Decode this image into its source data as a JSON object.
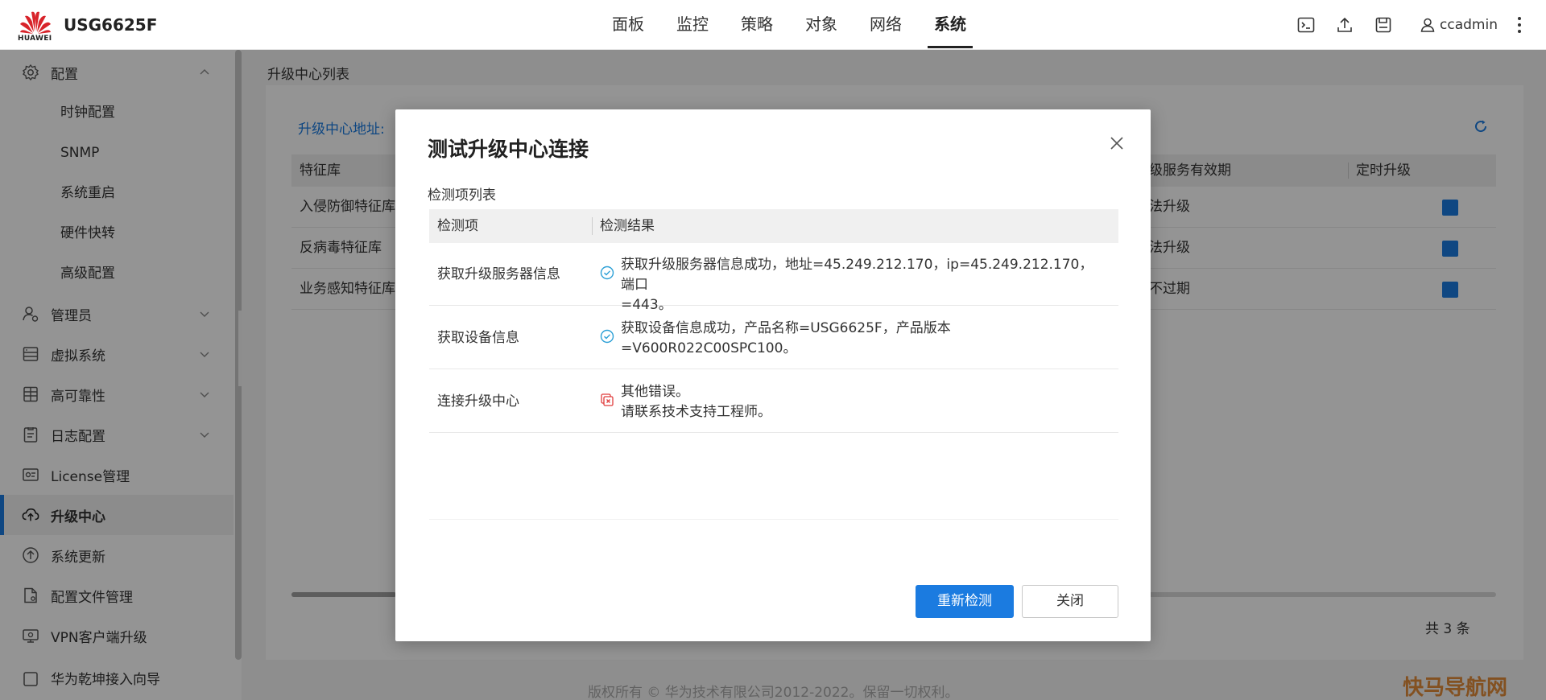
{
  "header": {
    "logo_text": "HUAWEI",
    "device": "USG6625F",
    "nav": [
      "面板",
      "监控",
      "策略",
      "对象",
      "网络",
      "系统"
    ],
    "active_nav": "系统",
    "user": "ccadmin"
  },
  "sidebar": {
    "config": "配置",
    "config_children": [
      "时钟配置",
      "SNMP",
      "系统重启",
      "硬件快转",
      "高级配置"
    ],
    "items": [
      "管理员",
      "虚拟系统",
      "高可靠性",
      "日志配置",
      "License管理",
      "升级中心",
      "系统更新",
      "配置文件管理",
      "VPN客户端升级",
      "华为乾坤接入向导"
    ],
    "active": "升级中心"
  },
  "main": {
    "breadcrumb": "升级中心列表",
    "address_label": "升级中心地址:",
    "columns": [
      "特征库",
      "级服务有效期",
      "定时升级"
    ],
    "rows": [
      {
        "name": "入侵防御特征库",
        "validity": "法升级",
        "scheduled": true
      },
      {
        "name": "反病毒特征库",
        "validity": "法升级",
        "scheduled": true
      },
      {
        "name": "业务感知特征库",
        "validity": "不过期",
        "scheduled": true
      }
    ],
    "total": "共 3 条",
    "footer": "版权所有 © 华为技术有限公司2012-2022。保留一切权利。",
    "watermark": "快马导航网"
  },
  "modal": {
    "title": "测试升级中心连接",
    "subtitle": "检测项列表",
    "columns": [
      "检测项",
      "检测结果"
    ],
    "rows": [
      {
        "item": "获取升级服务器信息",
        "status": "success",
        "line1": "获取升级服务器信息成功，地址=45.249.212.170，ip=45.249.212.170，端口",
        "line2": "=443。"
      },
      {
        "item": "获取设备信息",
        "status": "success",
        "line1": "获取设备信息成功，产品名称=USG6625F，产品版本",
        "line2": "=V600R022C00SPC100。"
      },
      {
        "item": "连接升级中心",
        "status": "error",
        "line1": "其他错误。",
        "line2": "请联系技术支持工程师。"
      }
    ],
    "retry": "重新检测",
    "close": "关闭"
  },
  "colors": {
    "primary": "#1b7be0",
    "success": "#2b9fd6",
    "error": "#e03c3c",
    "huawei_red": "#d8232a"
  }
}
